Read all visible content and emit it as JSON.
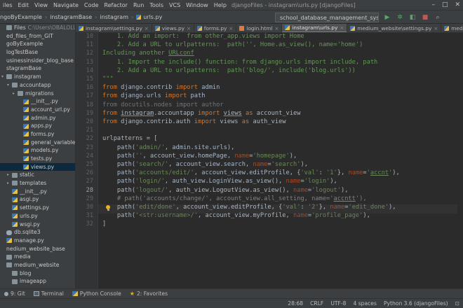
{
  "menubar": {
    "items": [
      "iles",
      "Edit",
      "View",
      "Navigate",
      "Code",
      "Refactor",
      "Run",
      "Tools",
      "VCS",
      "Window",
      "Help"
    ],
    "window_title": "djangoFiles - instagram\\urls.py [djangoFiles]",
    "controls": [
      "–",
      "□",
      "✕"
    ]
  },
  "navbar": {
    "breadcrumbs": [
      "ngoByExample",
      "instagramBase",
      "instagram",
      "urls.py"
    ],
    "run_config": "school_database_management_system (1)",
    "run_config_arrow": "▾"
  },
  "project_tree": [
    {
      "label": "Files",
      "note": "C:\\Users\\OBALOLUWA\\PyCh",
      "icon": "folder",
      "indent": 0,
      "twisty": ""
    },
    {
      "label": "ed_files_from_GIT",
      "icon": "none",
      "indent": 0,
      "twisty": ""
    },
    {
      "label": "goByExample",
      "icon": "none",
      "indent": 0,
      "twisty": ""
    },
    {
      "label": "logTestBase",
      "icon": "none",
      "indent": 0,
      "twisty": ""
    },
    {
      "label": "usinessinsider_blog_base",
      "icon": "none",
      "indent": 0,
      "twisty": ""
    },
    {
      "label": "stagramBase",
      "icon": "none",
      "indent": 0,
      "twisty": ""
    },
    {
      "label": "instagram",
      "icon": "folder",
      "indent": 0,
      "twisty": "▾"
    },
    {
      "label": "accountapp",
      "icon": "folder",
      "indent": 1,
      "twisty": "▾"
    },
    {
      "label": "migrations",
      "icon": "folder",
      "indent": 2,
      "twisty": "▸"
    },
    {
      "label": "__init__.py",
      "icon": "py",
      "indent": 3,
      "twisty": ""
    },
    {
      "label": "account_url.py",
      "icon": "py",
      "indent": 3,
      "twisty": ""
    },
    {
      "label": "admin.py",
      "icon": "py",
      "indent": 3,
      "twisty": ""
    },
    {
      "label": "apps.py",
      "icon": "py",
      "indent": 3,
      "twisty": ""
    },
    {
      "label": "forms.py",
      "icon": "py",
      "indent": 3,
      "twisty": ""
    },
    {
      "label": "general_variables.py",
      "icon": "py",
      "indent": 3,
      "twisty": ""
    },
    {
      "label": "models.py",
      "icon": "py",
      "indent": 3,
      "twisty": ""
    },
    {
      "label": "tests.py",
      "icon": "py",
      "indent": 3,
      "twisty": ""
    },
    {
      "label": "views.py",
      "icon": "py",
      "indent": 3,
      "twisty": ""
    },
    {
      "label": "static",
      "icon": "folder",
      "indent": 1,
      "twisty": "▸"
    },
    {
      "label": "templates",
      "icon": "folder",
      "indent": 1,
      "twisty": "▸"
    },
    {
      "label": "__init__.py",
      "icon": "py",
      "indent": 1,
      "twisty": ""
    },
    {
      "label": "asgi.py",
      "icon": "py",
      "indent": 1,
      "twisty": ""
    },
    {
      "label": "settings.py",
      "icon": "py",
      "indent": 1,
      "twisty": ""
    },
    {
      "label": "urls.py",
      "icon": "py",
      "indent": 1,
      "twisty": ""
    },
    {
      "label": "wsgi.py",
      "icon": "py",
      "indent": 1,
      "twisty": ""
    },
    {
      "label": "db.sqlite3",
      "icon": "db",
      "indent": 0,
      "twisty": ""
    },
    {
      "label": "manage.py",
      "icon": "py",
      "indent": 0,
      "twisty": ""
    },
    {
      "label": "nedium_website_base",
      "icon": "none",
      "indent": 0,
      "twisty": ""
    },
    {
      "label": "media",
      "icon": "folder",
      "indent": 0,
      "twisty": ""
    },
    {
      "label": "medium_website",
      "icon": "folder",
      "indent": 0,
      "twisty": ""
    },
    {
      "label": "blog",
      "icon": "folder",
      "indent": 1,
      "twisty": ""
    },
    {
      "label": "imageapp",
      "icon": "folder",
      "indent": 1,
      "twisty": ""
    }
  ],
  "tabs": [
    {
      "label": "instagram\\settings.py",
      "kind": "py",
      "active": false
    },
    {
      "label": "views.py",
      "kind": "py",
      "active": false
    },
    {
      "label": "forms.py",
      "kind": "py",
      "active": false
    },
    {
      "label": "login.html",
      "kind": "html",
      "active": false
    },
    {
      "label": "instagram\\urls.py",
      "kind": "py",
      "active": true
    },
    {
      "label": "medium_website\\settings.py",
      "kind": "py",
      "active": false
    },
    {
      "label": "medium_website\\urls.py",
      "kind": "py",
      "active": false
    }
  ],
  "tab_close": "×",
  "editor": {
    "line_numbers": [
      "",
      "",
      "",
      "",
      "",
      "",
      "",
      "",
      "",
      "",
      "",
      "",
      "",
      "",
      "",
      "",
      "",
      "",
      "",
      "",
      "",
      "",
      ""
    ],
    "visible_numbers": {
      "first": 10,
      "shown": [
        "10",
        "11",
        "12",
        "13",
        "14",
        "15",
        "16",
        "17",
        "18",
        "19",
        "20",
        "21",
        "22",
        "23",
        "24",
        "25",
        "26",
        "27",
        "28",
        "29",
        "30",
        "31",
        "32"
      ]
    },
    "current_line": "28",
    "lines_text": [
      "    1. Add an import:  from other_app.views import Home",
      "    2. Add a URL to urlpatterns:  path('', Home.as_view(), name='home')",
      "Including another URLconf",
      "    1. Import the include() function: from django.urls import include, path",
      "    2. Add a URL to urlpatterns:  path('blog/', include('blog.urls'))",
      "\"\"\"",
      "from django.contrib import admin",
      "from django.urls import path",
      "from docutils.nodes import author",
      "from instagram.accountapp import views as account_view",
      "from django.contrib.auth import views as auth_view",
      "",
      "urlpatterns = [",
      "    path('admin/', admin.site.urls),",
      "    path('', account_view.homePage, name='homepage'),",
      "    path('search/', account_view.search, name='search'),",
      "    path('accounts/edit/', account_view.editProfile, {'val': '1'}, name='accnt'),",
      "    path('login/', auth_view.LoginView.as_view(), name='login'),",
      "    path('logout/', auth_view.LogoutView.as_view(), name='logout'),",
      "    # path('accounts/change/', account_view.all_setting, name='accntt'),",
      "    path('edit/done', account_view.editProfile, {'val': '2'}, name='edit_done'),",
      "    path('<str:username>/', account_view.myProfile, name='profile_page'),",
      "]"
    ]
  },
  "bottombar": {
    "items": [
      "9: Git",
      "Terminal",
      "Python Console",
      "2: Favorites"
    ]
  },
  "statusbar": {
    "position": "28:68",
    "line_sep": "CRLF",
    "encoding": "UTF-8",
    "indent": "4 spaces",
    "interpreter": "Python 3.6 (djangoFiles)"
  },
  "colors": {
    "keyword": "#cc7832",
    "string": "#6a8759",
    "docstring": "#629755",
    "identifier": "#a9b7c6",
    "param_name": "#aa4926",
    "comment": "#808080"
  }
}
